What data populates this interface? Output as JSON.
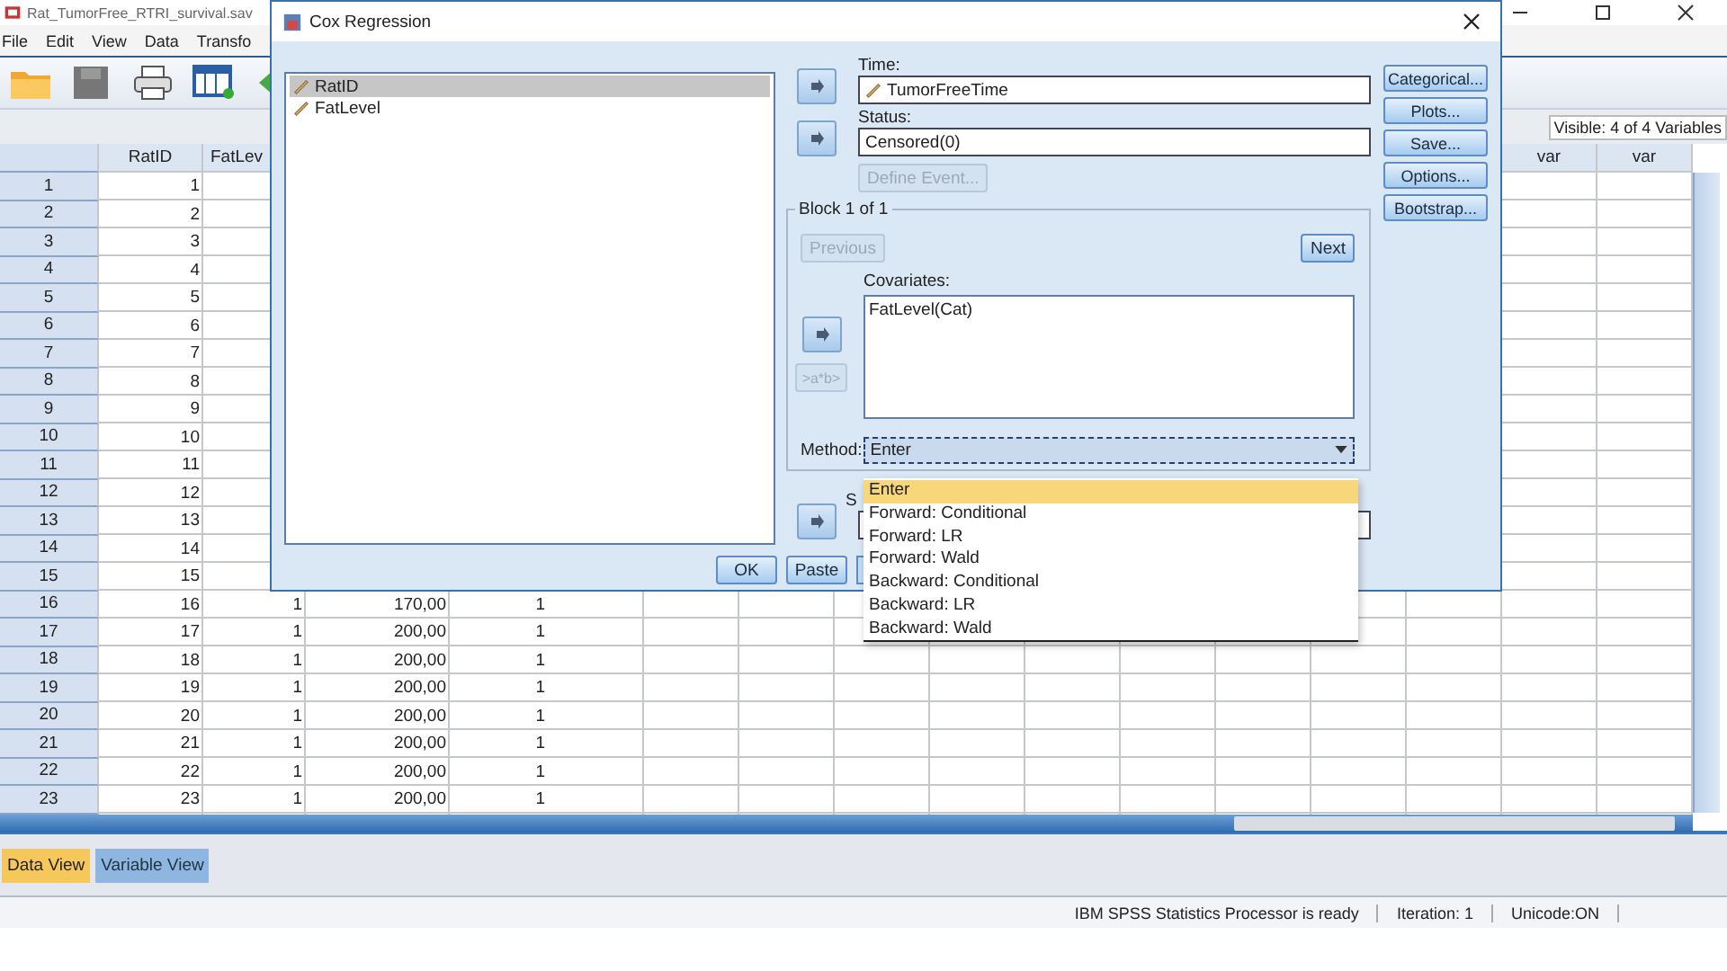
{
  "app": {
    "title": "Rat_TumorFree_RTRI_survival.sav",
    "menu": [
      "File",
      "Edit",
      "View",
      "Data",
      "Transfo"
    ],
    "visible_count": "Visible: 4 of 4 Variables"
  },
  "grid": {
    "columns_left": [
      "RatID",
      "FatLev"
    ],
    "columns_right": [
      "var",
      "var"
    ],
    "rows": [
      {
        "n": "1",
        "rat_id": "1"
      },
      {
        "n": "2",
        "rat_id": "2"
      },
      {
        "n": "3",
        "rat_id": "3"
      },
      {
        "n": "4",
        "rat_id": "4"
      },
      {
        "n": "5",
        "rat_id": "5"
      },
      {
        "n": "6",
        "rat_id": "6"
      },
      {
        "n": "7",
        "rat_id": "7"
      },
      {
        "n": "8",
        "rat_id": "8"
      },
      {
        "n": "9",
        "rat_id": "9"
      },
      {
        "n": "10",
        "rat_id": "10"
      },
      {
        "n": "11",
        "rat_id": "11"
      },
      {
        "n": "12",
        "rat_id": "12"
      },
      {
        "n": "13",
        "rat_id": "13"
      },
      {
        "n": "14",
        "rat_id": "14"
      },
      {
        "n": "15",
        "rat_id": "15"
      },
      {
        "n": "16",
        "rat_id": "16",
        "fat_level": "1",
        "time": "170,00",
        "status": "1"
      },
      {
        "n": "17",
        "rat_id": "17",
        "fat_level": "1",
        "time": "200,00",
        "status": "1"
      },
      {
        "n": "18",
        "rat_id": "18",
        "fat_level": "1",
        "time": "200,00",
        "status": "1"
      },
      {
        "n": "19",
        "rat_id": "19",
        "fat_level": "1",
        "time": "200,00",
        "status": "1"
      },
      {
        "n": "20",
        "rat_id": "20",
        "fat_level": "1",
        "time": "200,00",
        "status": "1"
      },
      {
        "n": "21",
        "rat_id": "21",
        "fat_level": "1",
        "time": "200,00",
        "status": "1"
      },
      {
        "n": "22",
        "rat_id": "22",
        "fat_level": "1",
        "time": "200,00",
        "status": "1"
      },
      {
        "n": "23",
        "rat_id": "23",
        "fat_level": "1",
        "time": "200,00",
        "status": "1"
      }
    ]
  },
  "view_tabs": [
    {
      "label": "Data View",
      "selected": true
    },
    {
      "label": "Variable View",
      "selected": false
    }
  ],
  "status_bar": [
    "IBM SPSS Statistics Processor is ready",
    "Iteration: 1",
    "Unicode:ON"
  ],
  "dialog": {
    "title": "Cox Regression",
    "variables": [
      {
        "name": "RatID",
        "selected": true
      },
      {
        "name": "FatLevel",
        "selected": false
      }
    ],
    "time": {
      "label": "Time:",
      "value": "TumorFreeTime"
    },
    "status": {
      "label": "Status:",
      "value": "Censored(0)"
    },
    "define_event": {
      "label": "Define Event...",
      "disabled": true
    },
    "block": {
      "legend": "Block 1 of 1",
      "previous": {
        "label": "Previous",
        "disabled": true
      },
      "next": {
        "label": "Next",
        "disabled": false
      },
      "covariates_label": "Covariates:",
      "covariates": [
        "FatLevel(Cat)"
      ],
      "interaction": {
        "label": ">a*b>",
        "disabled": true
      },
      "method_label": "Method:",
      "method": "Enter"
    },
    "method_options": [
      {
        "label": "Enter",
        "selected": true
      },
      {
        "label": "Forward: Conditional",
        "selected": false
      },
      {
        "label": "Forward: LR",
        "selected": false
      },
      {
        "label": "Forward: Wald",
        "selected": false
      },
      {
        "label": "Backward: Conditional",
        "selected": false
      },
      {
        "label": "Backward: LR",
        "selected": false
      },
      {
        "label": "Backward: Wald",
        "selected": false
      }
    ],
    "strata_label": "S",
    "buttons": [
      "OK",
      "Paste"
    ],
    "side_buttons": [
      "Categorical...",
      "Plots...",
      "Save...",
      "Options...",
      "Bootstrap..."
    ]
  }
}
